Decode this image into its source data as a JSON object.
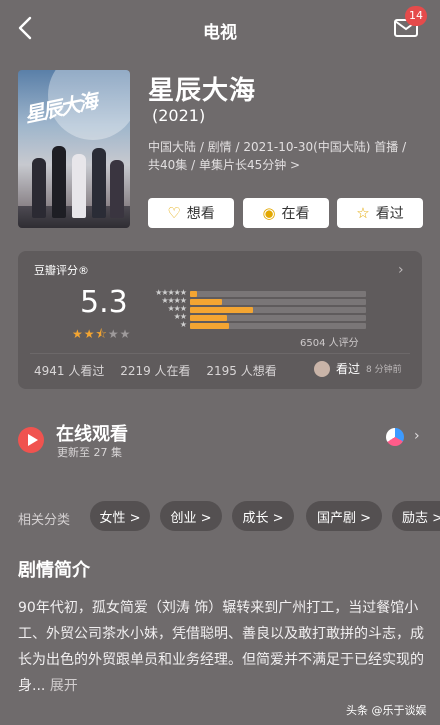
{
  "header": {
    "title": "电视",
    "badge_count": "14"
  },
  "movie": {
    "title": "星辰大海",
    "year": "(2021)",
    "poster_text": "星辰大海",
    "meta": "中国大陆 / 剧情 / 2021-10-30(中国大陆) 首播 / 共40集 / 单集片长45分钟 >"
  },
  "actions": [
    {
      "label": "想看",
      "icon": "heart-plus-icon",
      "glyph": "♡"
    },
    {
      "label": "在看",
      "icon": "watching-icon",
      "glyph": "◉"
    },
    {
      "label": "看过",
      "icon": "star-icon",
      "glyph": "☆"
    }
  ],
  "rating": {
    "source": "豆瓣评分®",
    "score": "5.3",
    "score_stars": 2.5,
    "stars_display": "★★★☆☆",
    "distribution": [
      {
        "stars": "★★★★★",
        "fraction": 0.04
      },
      {
        "stars": "★★★★",
        "fraction": 0.18
      },
      {
        "stars": "★★★",
        "fraction": 0.36
      },
      {
        "stars": "★★",
        "fraction": 0.21
      },
      {
        "stars": "★",
        "fraction": 0.22
      }
    ],
    "count": "6504 人评分",
    "stats": [
      "4941 人看过",
      "2219 人在看",
      "2195 人想看"
    ],
    "my_status": "看过",
    "my_time": "8 分钟前",
    "accent": "#f3a532"
  },
  "watch": {
    "title": "在线观看",
    "subtitle": "更新至 27 集",
    "play_color": "#f0534f"
  },
  "categories": {
    "label": "相关分类",
    "items": [
      "女性 >",
      "创业 >",
      "成长 >",
      "国产剧 >",
      "励志 >"
    ]
  },
  "synopsis": {
    "title": "剧情简介",
    "body": "90年代初，孤女简爱（刘涛 饰）辗转来到广州打工，当过餐馆小工、外贸公司茶水小妹，凭借聪明、善良以及敢打敢拼的斗志，成长为出色的外贸跟单员和业务经理。但简爱并不满足于已经实现的身...",
    "more": "展开"
  },
  "watermark": "头条 @乐于谈娱"
}
